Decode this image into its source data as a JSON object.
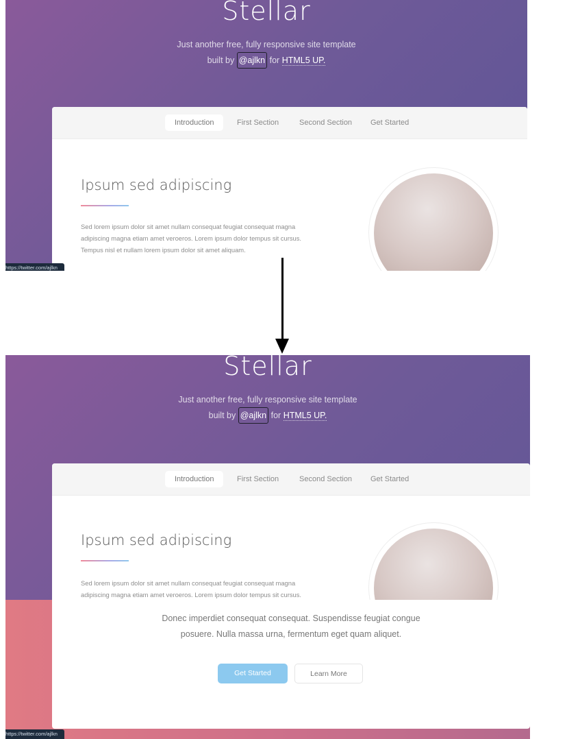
{
  "site": {
    "title": "Stellar",
    "tagline_line1": "Just another free, fully responsive site template",
    "tagline_built_by": "built by",
    "tagline_credit": "@ajlkn",
    "tagline_for": "for",
    "tagline_html5": "HTML5 UP."
  },
  "nav": {
    "items": [
      {
        "label": "Introduction",
        "active": true
      },
      {
        "label": "First Section",
        "active": false
      },
      {
        "label": "Second Section",
        "active": false
      },
      {
        "label": "Get Started",
        "active": false
      }
    ]
  },
  "intro": {
    "heading": "Ipsum sed adipiscing",
    "text_lines": [
      "Sed lorem ipsum dolor sit amet nullam consequat feugiat consequat magna",
      "adipiscing magna etiam amet veroeros. Lorem ipsum dolor tempus sit cursus.",
      "Tempus nisl et nullam lorem ipsum dolor sit amet aliquam."
    ]
  },
  "status_bar": {
    "url": "https://twitter.com/ajlkn"
  },
  "get_started": {
    "text_lines": [
      "Donec imperdiet consequat consequat. Suspendisse feugiat congue",
      "posuere. Nulla massa urna, fermentum eget quam aliquet."
    ],
    "primary_button": "Get Started",
    "secondary_button": "Learn More"
  },
  "colors": {
    "header_gradient": [
      "#8a5a9a",
      "#5c5496"
    ],
    "lower_gradient": [
      "#e07a84",
      "#b46a8e"
    ],
    "primary_button": "#8cc9ef"
  }
}
